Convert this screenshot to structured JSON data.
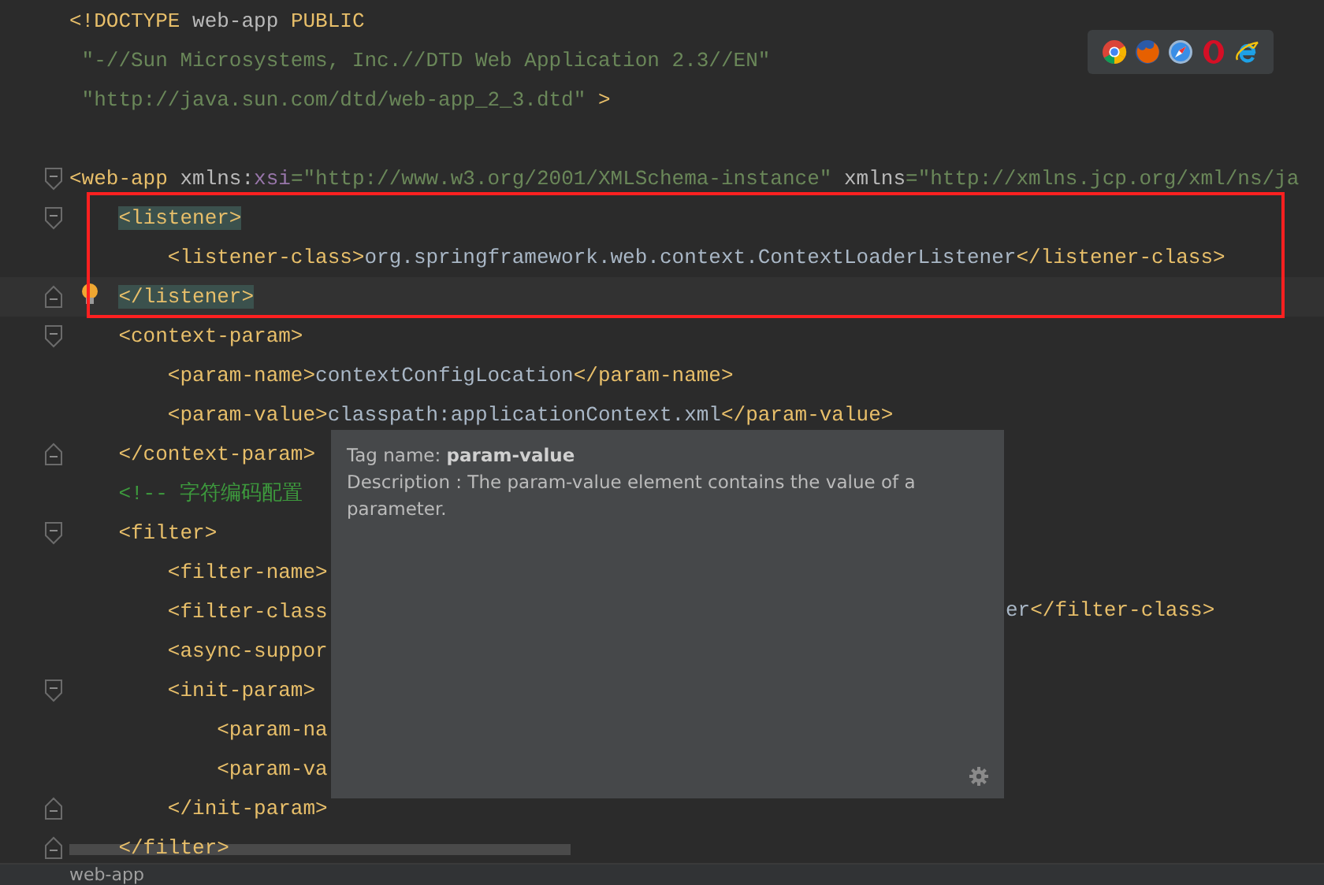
{
  "editor": {
    "lines": [
      {
        "segments": [
          {
            "kind": "tag",
            "text": "<!DOCTYPE "
          },
          {
            "kind": "plain",
            "text": "web-app "
          },
          {
            "kind": "tag",
            "text": "PUBLIC"
          }
        ]
      },
      {
        "segments": [
          {
            "kind": "string",
            "text": " \"-//Sun Microsystems, Inc.//DTD Web Application 2.3//EN\""
          }
        ]
      },
      {
        "blank_after": true,
        "segments": [
          {
            "kind": "string",
            "text": " \"http://java.sun.com/dtd/web-app_2_3.dtd\""
          },
          {
            "kind": "tag",
            "text": " >"
          }
        ]
      },
      {
        "fold_start": true,
        "segments": [
          {
            "kind": "tag",
            "text": "<web-app "
          },
          {
            "kind": "attr",
            "text": "xmlns:"
          },
          {
            "kind": "ns",
            "text": "xsi"
          },
          {
            "kind": "string",
            "text": "=\"http://www.w3.org/2001/XMLSchema-instance\" "
          },
          {
            "kind": "attr",
            "text": "xmlns"
          },
          {
            "kind": "string",
            "text": "=\"http://xmlns.jcp.org/xml/ns/ja"
          }
        ]
      },
      {
        "fold_start": true,
        "segments": [
          {
            "kind": "tag",
            "text": "    <listener>",
            "matched": true
          }
        ]
      },
      {
        "segments": [
          {
            "kind": "tag",
            "text": "        <listener-class>"
          },
          {
            "kind": "text",
            "text": "org.springframework.web.context.ContextLoaderListener"
          },
          {
            "kind": "tag",
            "text": "</listener-class>"
          }
        ]
      },
      {
        "fold_end": true,
        "current": true,
        "bulb": true,
        "segments": [
          {
            "kind": "tag",
            "text": "    </listener>",
            "matched": true
          }
        ]
      },
      {
        "fold_start": true,
        "segments": [
          {
            "kind": "tag",
            "text": "    <context-param>"
          }
        ]
      },
      {
        "segments": [
          {
            "kind": "tag",
            "text": "        <param-name>"
          },
          {
            "kind": "text",
            "text": "contextConfigLocation"
          },
          {
            "kind": "tag",
            "text": "</param-name>"
          }
        ]
      },
      {
        "segments": [
          {
            "kind": "tag",
            "text": "        <param-value>"
          },
          {
            "kind": "text",
            "text": "classpath:applicationContext.xml"
          },
          {
            "kind": "tag",
            "text": "</param-value>"
          }
        ]
      },
      {
        "fold_end": true,
        "segments": [
          {
            "kind": "tag",
            "text": "    </context-param>"
          }
        ]
      },
      {
        "segments": [
          {
            "kind": "comment",
            "text": "    <!-- 字符编码配置"
          }
        ]
      },
      {
        "fold_start": true,
        "segments": [
          {
            "kind": "tag",
            "text": "    <filter>"
          }
        ]
      },
      {
        "segments": [
          {
            "kind": "tag",
            "text": "        <filter-name>"
          }
        ]
      },
      {
        "segments": [
          {
            "kind": "tag",
            "text": "        <filter-class"
          }
        ],
        "after": [
          {
            "kind": "text",
            "text": "er"
          },
          {
            "kind": "tag",
            "text": "</filter-class>"
          }
        ]
      },
      {
        "segments": [
          {
            "kind": "tag",
            "text": "        <async-suppor"
          }
        ]
      },
      {
        "fold_start": true,
        "segments": [
          {
            "kind": "tag",
            "text": "        <init-param>"
          }
        ]
      },
      {
        "segments": [
          {
            "kind": "tag",
            "text": "            <param-na"
          }
        ]
      },
      {
        "segments": [
          {
            "kind": "tag",
            "text": "            <param-va"
          }
        ]
      },
      {
        "fold_end": true,
        "segments": [
          {
            "kind": "tag",
            "text": "        </init-param>"
          }
        ]
      },
      {
        "fold_end": true,
        "segments": [
          {
            "kind": "tag",
            "text": "    </filter>"
          }
        ]
      }
    ]
  },
  "tooltip": {
    "title": "Tag name: **param-value**",
    "description": "Description : The param-value element contains the value of a parameter."
  },
  "status_bar": {
    "breadcrumb": "web-app"
  }
}
